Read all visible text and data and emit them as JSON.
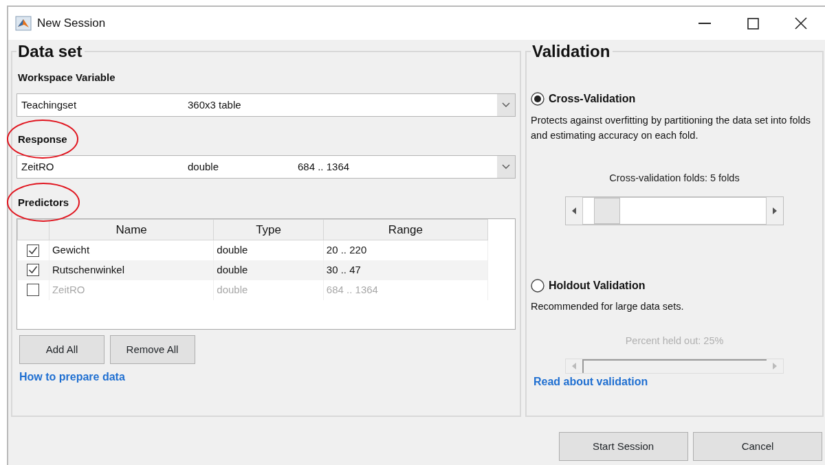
{
  "window": {
    "title": "New Session"
  },
  "data_set": {
    "title": "Data set",
    "workspace_variable": {
      "label": "Workspace Variable",
      "circled": false,
      "value": [
        "Teachingset",
        "360x3 table"
      ]
    },
    "response": {
      "label": "Response",
      "circled": true,
      "value": [
        "ZeitRO",
        "double",
        "684 .. 1364"
      ]
    },
    "predictors": {
      "label": "Predictors",
      "circled": true,
      "columns": [
        "Name",
        "Type",
        "Range"
      ],
      "rows": [
        {
          "checked": true,
          "disabled": false,
          "cells": [
            "Gewicht",
            "double",
            "20 .. 220"
          ]
        },
        {
          "checked": true,
          "disabled": false,
          "cells": [
            "Rutschenwinkel",
            "double",
            "30 .. 47"
          ]
        },
        {
          "checked": false,
          "disabled": true,
          "cells": [
            "ZeitRO",
            "double",
            "684 .. 1364"
          ]
        }
      ]
    },
    "buttons": [
      "Add All",
      "Remove All"
    ],
    "link": "How to prepare data"
  },
  "validation": {
    "title": "Validation",
    "options": [
      {
        "label": "Cross-Validation",
        "selected": true,
        "description": "Protects against overfitting by partitioning the data set into folds and estimating accuracy on each fold.",
        "slider_label": "Cross-validation folds: 5 folds",
        "disabled": false,
        "level": 0.06
      },
      {
        "label": "Holdout Validation",
        "selected": false,
        "description": "Recommended for large data sets.",
        "slider_label": "Percent held out: 25%",
        "disabled": true
      }
    ],
    "link": "Read about validation"
  },
  "buttons": [
    "Start Session",
    "Cancel"
  ]
}
